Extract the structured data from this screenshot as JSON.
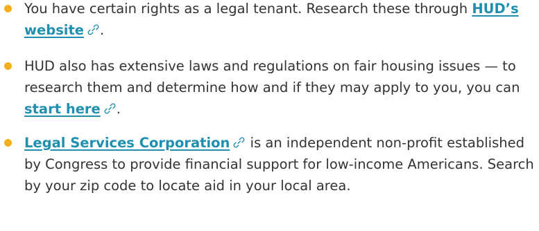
{
  "colors": {
    "bullet": "#f2b01e",
    "link": "#1f8fb0",
    "text": "#333333"
  },
  "items": [
    {
      "text_before": "You have certain rights as a legal tenant. Research these through ",
      "link_label": "HUD’s website",
      "link_icon": "link-chain-icon",
      "text_after": "."
    },
    {
      "text_before": "HUD also has extensive laws and regulations on fair housing issues — to research them and determine how and if they may apply to you, you can ",
      "link_label": "start here",
      "link_icon": "link-chain-icon",
      "text_after": "."
    },
    {
      "text_before": "",
      "link_label": "Legal Services Corporation",
      "link_icon": "link-chain-icon",
      "text_after": " is an independent non-profit established by Congress to provide financial support for low-income Americans. Search by your zip code to locate aid in your local area."
    }
  ]
}
